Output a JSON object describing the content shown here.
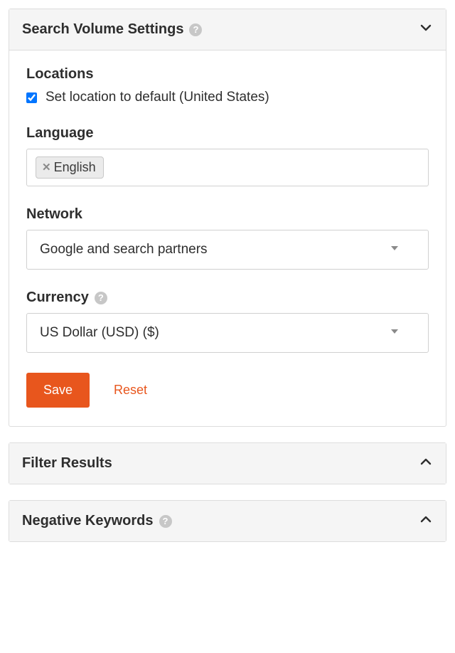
{
  "panels": {
    "searchVolume": {
      "title": "Search Volume Settings",
      "expanded": true,
      "locations": {
        "label": "Locations",
        "checkboxLabel": "Set location to default (United States)",
        "checked": true
      },
      "language": {
        "label": "Language",
        "tag": "English"
      },
      "network": {
        "label": "Network",
        "value": "Google and search partners"
      },
      "currency": {
        "label": "Currency",
        "value": "US Dollar (USD) ($)"
      },
      "buttons": {
        "save": "Save",
        "reset": "Reset"
      }
    },
    "filterResults": {
      "title": "Filter Results",
      "expanded": false
    },
    "negativeKeywords": {
      "title": "Negative Keywords",
      "expanded": false
    }
  }
}
